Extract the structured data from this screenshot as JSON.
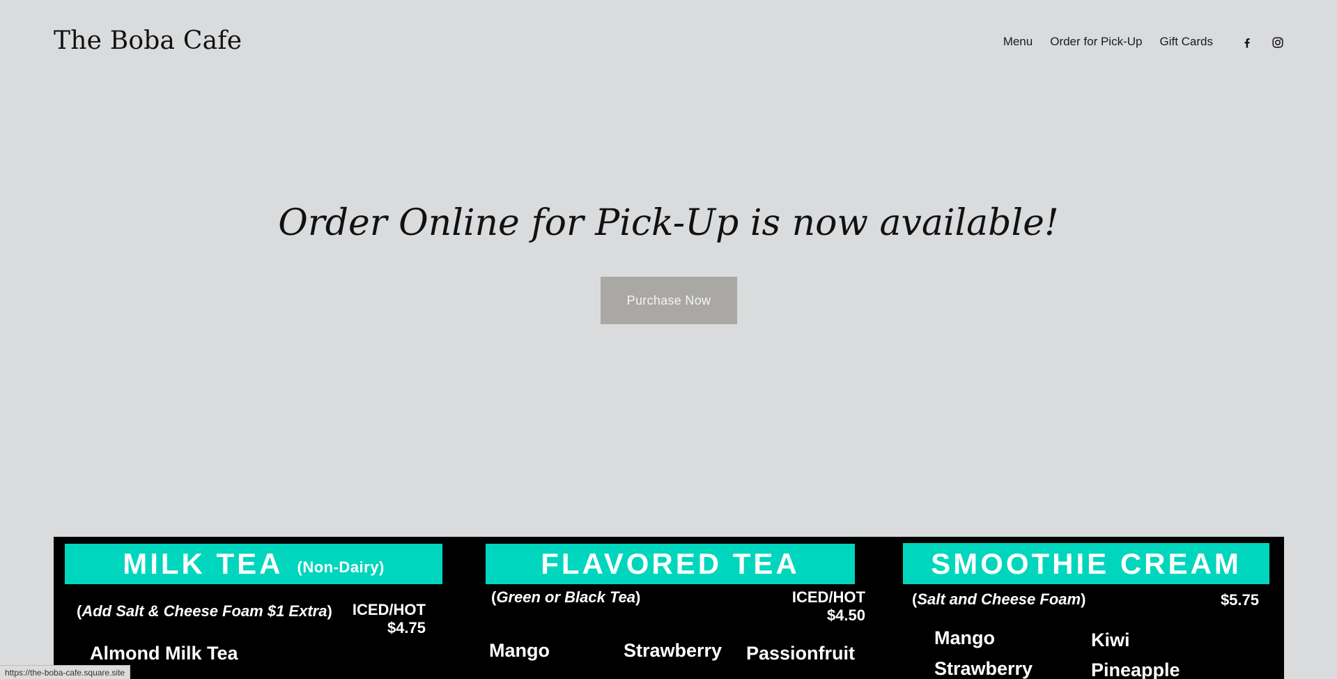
{
  "header": {
    "site_title": "The Boba Cafe",
    "nav": [
      "Menu",
      "Order for Pick-Up",
      "Gift Cards"
    ],
    "social": [
      "facebook-icon",
      "instagram-icon"
    ]
  },
  "hero": {
    "heading": "Order Online for Pick-Up is now available!",
    "button_label": "Purchase Now"
  },
  "menu_board": {
    "sections": [
      {
        "title": "MILK TEA",
        "title_suffix": "(Non-Dairy)",
        "subtitle_open": "(",
        "subtitle_italic": "Add Salt & Cheese Foam $1 Extra",
        "subtitle_close": ")",
        "price_label": "ICED/HOT",
        "price": "$4.75",
        "items": [
          "Almond Milk Tea"
        ]
      },
      {
        "title": "FLAVORED TEA",
        "subtitle_open": "(",
        "subtitle_italic": "Green or Black Tea",
        "subtitle_close": ")",
        "price_label": "ICED/HOT",
        "price": "$4.50",
        "items": [
          "Mango",
          "Strawberry",
          "Passionfruit"
        ]
      },
      {
        "title": "SMOOTHIE CREAM",
        "subtitle_open": "(",
        "subtitle_italic": "Salt and Cheese Foam",
        "subtitle_close": ")",
        "price": "$5.75",
        "items": [
          "Mango",
          "Kiwi",
          "Strawberry",
          "Pineapple"
        ]
      }
    ]
  },
  "status_bar": {
    "url": "https://the-boba-cafe.square.site"
  },
  "colors": {
    "page_background": "#dadbdd",
    "button_background": "#a9a8a4",
    "banner_teal": "#00d6bd",
    "board_background": "#000000"
  }
}
